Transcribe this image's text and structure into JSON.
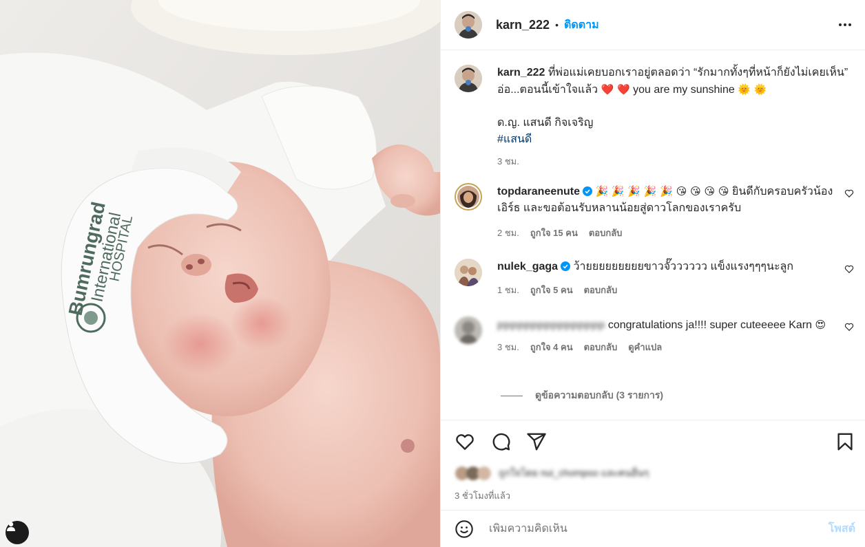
{
  "post": {
    "author": "karn_222",
    "follow_label": "ติดตาม",
    "separator": "•",
    "caption_part1": "ที่พ่อแม่เคยบอกเราอยู่ตลอดว่า “รักมากทั้งๆที่หน้าก็ยังไม่เคยเห็น” อ่อ...ตอนนี้เข้าใจแล้ว",
    "caption_hearts": "❤️ ❤️",
    "caption_part2": "you are my sunshine",
    "caption_suns": "🌞 🌞",
    "caption_line2": "ด.ญ. แสนดี กิจเจริญ",
    "hashtag": "#แสนดี",
    "caption_time": "3 ชม."
  },
  "comments": [
    {
      "user": "topdaraneenute",
      "verified": true,
      "emojis": "🎉 🎉 🎉 🎉 🎉 😘 😘 😘 😘",
      "text": "ยินดีกับครอบครัวน้องเอิร์ธ และขอต้อนรับหลานน้อยสู่ดาวโลกของเราครับ",
      "time": "2 ชม.",
      "likes": "ถูกใจ 15 คน",
      "reply": "ตอบกลับ"
    },
    {
      "user": "nulek_gaga",
      "verified": true,
      "text": "ว้ายยยยยยยยยขาวจั๊วววววว แข็งแรงๆๆๆนะลูก",
      "time": "1 ชม.",
      "likes": "ถูกใจ 5 คน",
      "reply": "ตอบกลับ"
    },
    {
      "user": "pppppppppppppppp",
      "verified": false,
      "text": "congratulations ja!!!! super cuteeeee Karn",
      "emoji_after": "😍",
      "time": "3 ชม.",
      "likes": "ถูกใจ 4 คน",
      "reply": "ตอบกลับ",
      "translate": "ดูคำแปล"
    }
  ],
  "view_replies": "ดูข้อความตอบกลับ (3 รายการ)",
  "liked_by": "ถูกใจโดย nui_chompoo และคนอื่นๆ",
  "post_time": "3 ชั่วโมงที่แล้ว",
  "add_comment_placeholder": "เพิ่มความคิดเห็น",
  "post_button": "โพสต์",
  "colors": {
    "accent": "#0095f6",
    "hashtag": "#00376b",
    "muted": "#737373",
    "post_disabled": "#b3dbff"
  },
  "icons": [
    "heart-icon",
    "comment-icon",
    "share-icon",
    "bookmark-icon",
    "emoji-icon",
    "more-icon",
    "verified-icon",
    "user-tag-icon"
  ]
}
